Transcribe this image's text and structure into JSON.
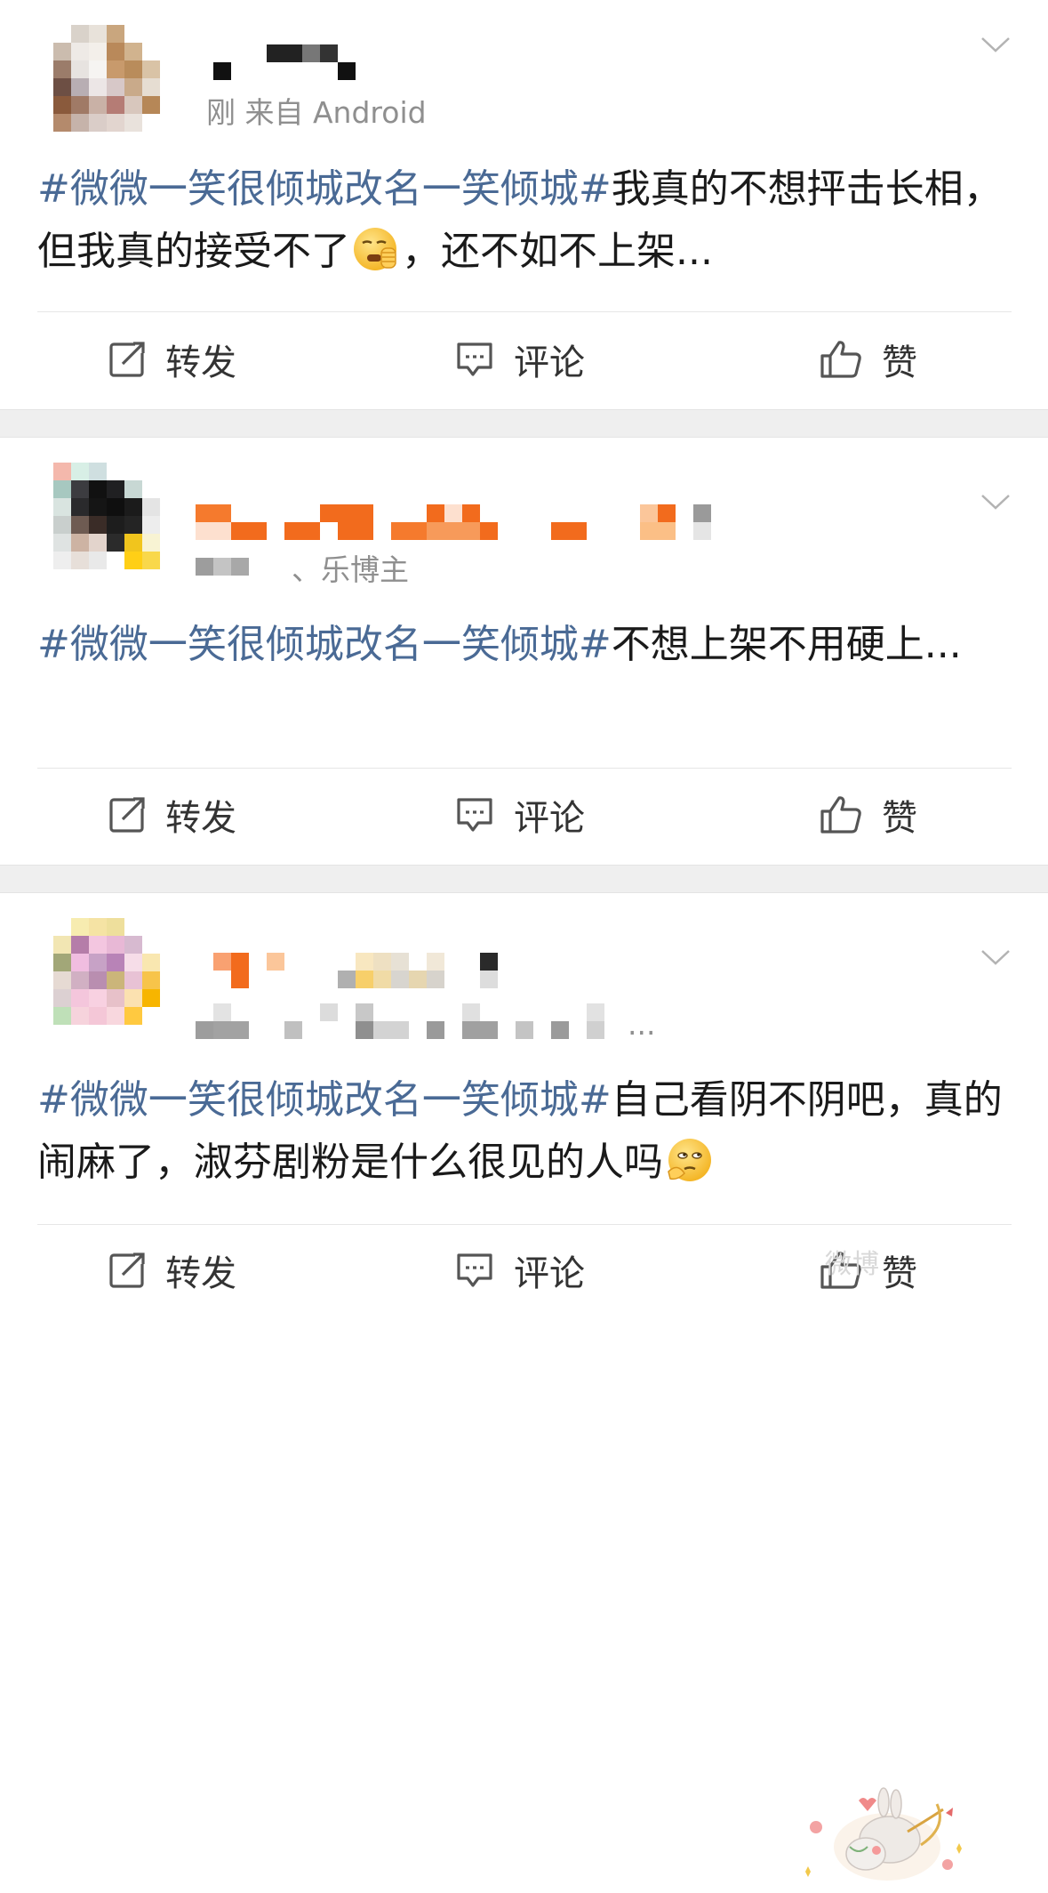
{
  "posts": [
    {
      "meta_text": "刚  来自 Android",
      "topic": "#微微一笑很倾城改名一笑倾城#",
      "text_before_emoji": "我真的不想抨击长相，但我真的接受不了",
      "emoji_icon": "yawn-face-emoji",
      "text_after_emoji": "，还不如不上架...",
      "actions": {
        "repost": "转发",
        "comment": "评论",
        "like": "赞"
      }
    },
    {
      "meta_text": "、乐博主",
      "topic": "#微微一笑很倾城改名一笑倾城#",
      "text_before_emoji": "不想上架不用硬上...",
      "emoji_icon": "",
      "text_after_emoji": "",
      "actions": {
        "repost": "转发",
        "comment": "评论",
        "like": "赞"
      }
    },
    {
      "meta_text": "...",
      "topic": "#微微一笑很倾城改名一笑倾城#",
      "text_before_emoji": "自己看阴不阴吧，真的闹麻了，淑芬剧粉是什么很见的人吗",
      "emoji_icon": "thinking-skeptical-emoji",
      "text_after_emoji": "",
      "actions": {
        "repost": "转发",
        "comment": "评论",
        "like": "赞"
      }
    }
  ],
  "watermark": "微博",
  "colors": {
    "topic_link": "#4a6a95",
    "meta_gray": "#8f8f8f",
    "separator_band": "#efefef",
    "name_orange": "#f26b1d"
  }
}
